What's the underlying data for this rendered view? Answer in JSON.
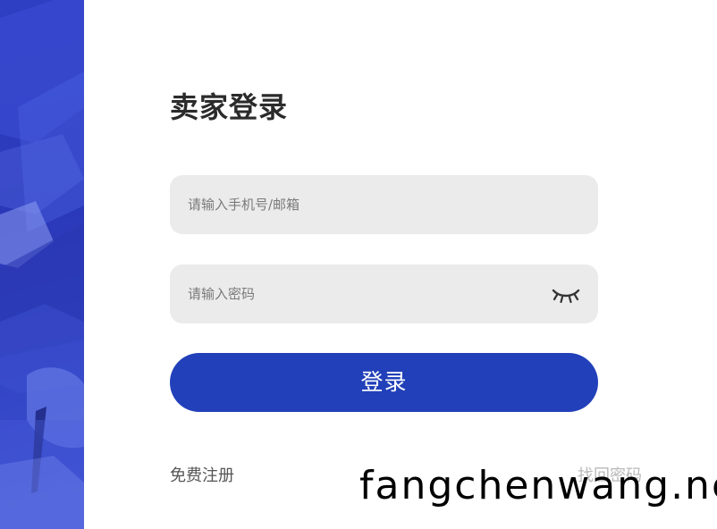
{
  "login": {
    "title": "卖家登录",
    "account_placeholder": "请输入手机号/邮箱",
    "account_value": "",
    "password_placeholder": "请输入密码",
    "password_value": "",
    "password_toggle_icon": "eye-closed-icon",
    "submit_label": "登录",
    "register_link": "免费注册",
    "forgot_link": "找回密码"
  },
  "watermark": {
    "text": "fangchenwang.net"
  },
  "colors": {
    "primary": "#2240b9",
    "input_bg": "#ebebeb",
    "side_panel": "#2f3fc4"
  }
}
